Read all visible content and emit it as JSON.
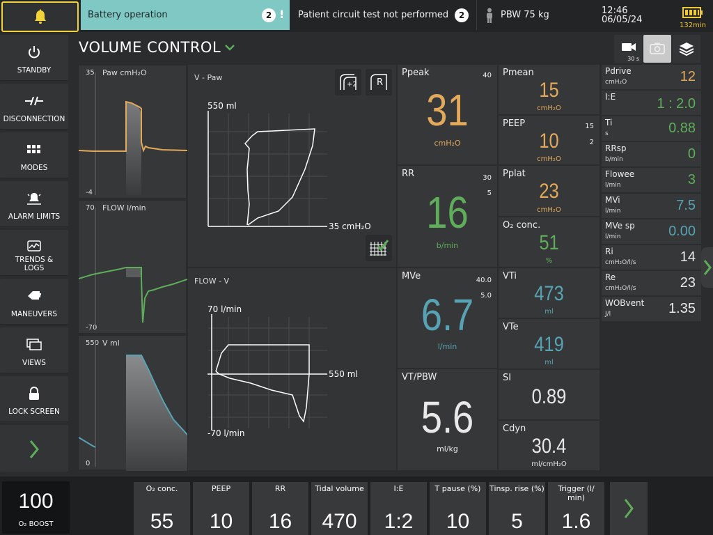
{
  "topbar": {
    "alarm_text": "Battery operation",
    "alarm_count": "2",
    "alarm_excl": "!",
    "circuit_text": "Patient circuit test not performed",
    "circuit_count": "2",
    "pbw": "PBW 75 kg",
    "time": "12:46",
    "date": "06/05/24",
    "battery_minutes": "132min",
    "icons": [
      "bell-icon",
      "person-icon",
      "battery-icon"
    ],
    "colors": {
      "alarm_yellow": "#f2d43a",
      "banner": "#7fc8c4"
    }
  },
  "nav": {
    "standby": "STANDBY",
    "disconnection": "DISCONNECTION",
    "modes": "MODES",
    "alarm_limits": "ALARM LIMITS",
    "trends": "TRENDS &",
    "logs": "LOGS",
    "maneuvers": "MANEUVERS",
    "views": "VIEWS",
    "lock": "LOCK SCREEN"
  },
  "mode": {
    "title": "VOLUME CONTROL"
  },
  "header_icons": {
    "camera_label": "30 s"
  },
  "waveforms": {
    "paw": {
      "label": "Paw cmH₂O",
      "max": "35",
      "min": "-4"
    },
    "flow": {
      "label": "FLOW l/min",
      "max": "70",
      "min": "-70"
    },
    "vol": {
      "label": "V ml",
      "max": "550",
      "min": "0"
    }
  },
  "loops": {
    "vpaw": {
      "title": "V - Paw",
      "y_label": "550 ml",
      "x_label": "35 cmH₂O",
      "btn1": "+2",
      "btn2": "R"
    },
    "flowv": {
      "title": "FLOW - V",
      "y_top": "70 l/min",
      "x_label": "550 ml",
      "y_bottom": "-70 l/min"
    }
  },
  "tiles": {
    "ppeak": {
      "name": "Ppeak",
      "limit": "40",
      "value": "31",
      "unit": "cmH₂O"
    },
    "pmean": {
      "name": "Pmean",
      "value": "15",
      "unit": "cmH₂O"
    },
    "peep": {
      "name": "PEEP",
      "limit_hi": "15",
      "limit_lo": "2",
      "value": "10",
      "unit": "cmH₂O"
    },
    "rr": {
      "name": "RR",
      "limit_hi": "30",
      "limit_lo": "5",
      "value": "16",
      "unit": "b/min"
    },
    "pplat": {
      "name": "Pplat",
      "value": "23",
      "unit": "cmH₂O"
    },
    "o2": {
      "name": "O₂ conc.",
      "value": "51",
      "unit": "%"
    },
    "mve": {
      "name": "MVe",
      "limit_hi": "40.0",
      "limit_lo": "5.0",
      "value": "6.7",
      "unit": "l/min"
    },
    "vti": {
      "name": "VTi",
      "value": "473",
      "unit": "ml"
    },
    "vte": {
      "name": "VTe",
      "value": "419",
      "unit": "ml"
    },
    "vtpbw": {
      "name": "VT/PBW",
      "value": "5.6",
      "unit": "ml/kg"
    },
    "si": {
      "name": "SI",
      "value": "0.89"
    },
    "cdyn": {
      "name": "Cdyn",
      "value": "30.4",
      "unit": "ml/cmH₂O"
    }
  },
  "small_tiles": [
    {
      "name": "Pdrive",
      "unit": "cmH₂O",
      "value": "12",
      "color": "#e2a95a"
    },
    {
      "name": "I:E",
      "unit": "",
      "value": "1 : 2.0",
      "color": "#5fad5a"
    },
    {
      "name": "Ti",
      "unit": "s",
      "value": "0.88",
      "color": "#5fad5a"
    },
    {
      "name": "RRsp",
      "unit": "b/min",
      "value": "0",
      "color": "#5fad5a"
    },
    {
      "name": "Flowee",
      "unit": "l/min",
      "value": "3",
      "color": "#5fad5a"
    },
    {
      "name": "MVi",
      "unit": "l/min",
      "value": "7.5",
      "color": "#58a3b3"
    },
    {
      "name": "MVe sp",
      "unit": "l/min",
      "value": "0.00",
      "color": "#58a3b3"
    },
    {
      "name": "Ri",
      "unit": "cmH₂O/l/s",
      "value": "14",
      "color": "#e8e8e8"
    },
    {
      "name": "Re",
      "unit": "cmH₂O/l/s",
      "value": "23",
      "color": "#e8e8e8"
    },
    {
      "name": "WOBvent",
      "unit": "J/l",
      "value": "1.35",
      "color": "#e8e8e8"
    }
  ],
  "settings": {
    "boost_value": "100",
    "boost_label": "O₂ BOOST",
    "items": [
      {
        "label": "O₂ conc.",
        "value": "55"
      },
      {
        "label": "PEEP",
        "value": "10"
      },
      {
        "label": "RR",
        "value": "16"
      },
      {
        "label": "Tidal volume",
        "value": "470"
      },
      {
        "label": "I:E",
        "value": "1:2"
      },
      {
        "label": "T pause (%)",
        "value": "10"
      },
      {
        "label": "Tinsp. rise (%)",
        "value": "5"
      },
      {
        "label": "Trigger (l/ min)",
        "value": "1.6"
      }
    ]
  }
}
